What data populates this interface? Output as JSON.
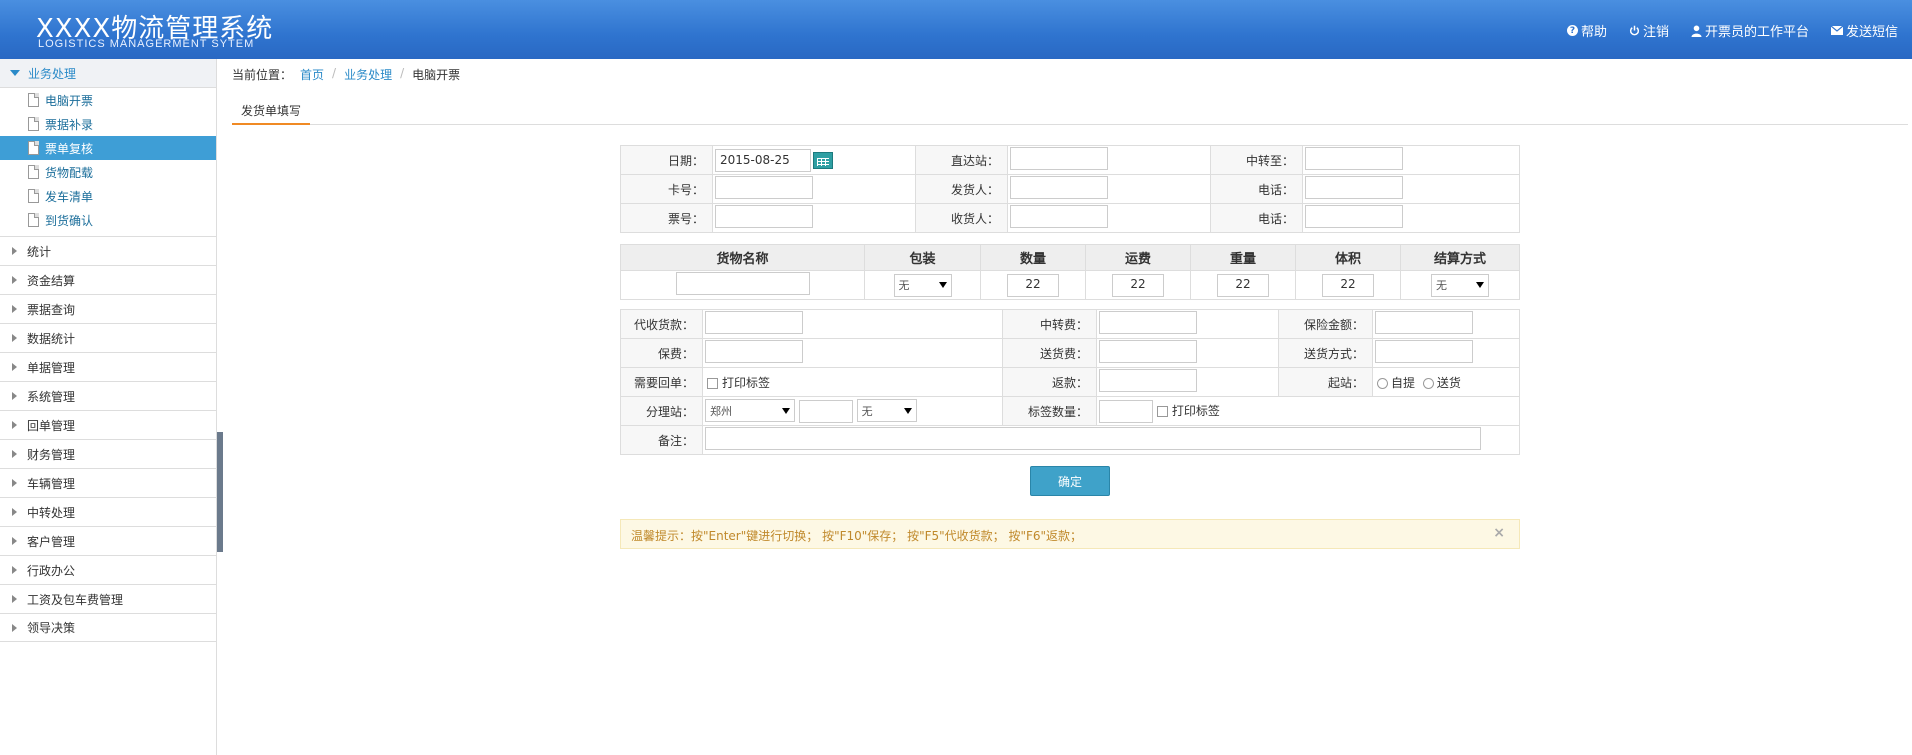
{
  "header": {
    "title_cn": "XXXX物流管理系统",
    "title_en": "LOGISTICS MANAGERMENT SYTEM",
    "nav": [
      {
        "label": "帮助",
        "icon": "help-icon"
      },
      {
        "label": "注销",
        "icon": "power-icon"
      },
      {
        "label": "开票员的工作平台",
        "icon": "user-icon"
      },
      {
        "label": "发送短信",
        "icon": "mail-icon"
      }
    ]
  },
  "sidebar": {
    "open_group": "业务处理",
    "sub_items": [
      "电脑开票",
      "票据补录",
      "票单复核",
      "货物配载",
      "发车清单",
      "到货确认"
    ],
    "active_sub": "票单复核",
    "groups": [
      "统计",
      "资金结算",
      "票据查询",
      "数据统计",
      "单据管理",
      "系统管理",
      "回单管理",
      "财务管理",
      "车辆管理",
      "中转处理",
      "客户管理",
      "行政办公",
      "工资及包车费管理",
      "领导决策"
    ]
  },
  "breadcrumb": {
    "prefix": "当前位置：",
    "home": "首页",
    "section": "业务处理",
    "current": "电脑开票"
  },
  "tab": {
    "label": "发货单填写"
  },
  "form1": {
    "date_label": "日期：",
    "date_value": "2015-08-25",
    "direct_label": "直达站：",
    "transfer_to_label": "中转至：",
    "card_label": "卡号：",
    "sender_label": "发货人：",
    "phone1_label": "电话：",
    "ticket_label": "票号：",
    "receiver_label": "收货人：",
    "phone2_label": "电话："
  },
  "goods": {
    "headers": [
      "货物名称",
      "包装",
      "数量",
      "运费",
      "重量",
      "体积",
      "结算方式"
    ],
    "package_value": "无",
    "qty": "22",
    "freight": "22",
    "weight": "22",
    "volume": "22",
    "settle_value": "无"
  },
  "form2": {
    "cod_label": "代收货款：",
    "transfer_fee_label": "中转费：",
    "insured_label": "保险金额：",
    "insure_fee_label": "保费：",
    "delivery_fee_label": "送货费：",
    "delivery_mode_label": "送货方式：",
    "need_receipt_label": "需要回单：",
    "print_label_text": "打印标签",
    "rebate_label": "返款：",
    "start_label": "起站：",
    "self_pick": "自提",
    "deliver": "送货",
    "branch_label": "分理站：",
    "branch_value": "郑州",
    "branch_sel2": "无",
    "label_count_label": "标签数量：",
    "print_label_text2": "打印标签",
    "remark_label": "备注："
  },
  "confirm_button": "确定",
  "tip": "温馨提示：按\"Enter\"键进行切换； 按\"F10\"保存； 按\"F5\"代收货款； 按\"F6\"返款；",
  "tip_close": "×"
}
